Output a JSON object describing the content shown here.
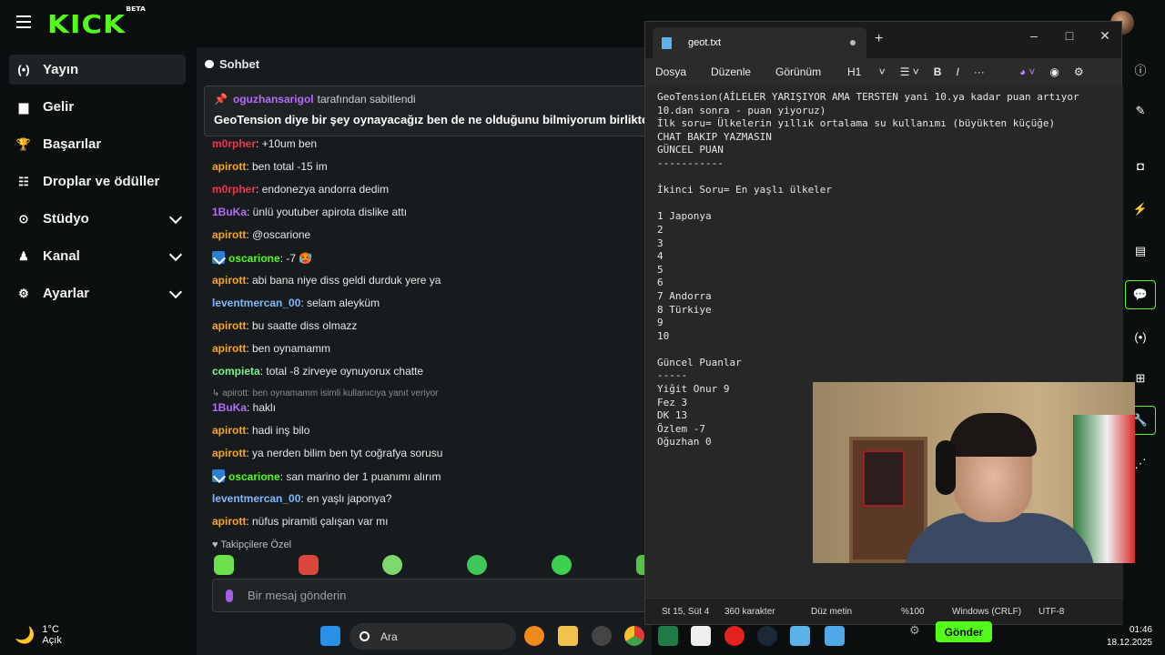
{
  "app": {
    "logo": "KICK",
    "logo_tag": "BETA"
  },
  "sidebar": {
    "items": [
      {
        "label": "Yayın",
        "icon": "broadcast-icon",
        "glyph": "(•)",
        "active": true,
        "expandable": false
      },
      {
        "label": "Gelir",
        "icon": "chart-icon",
        "glyph": "▆",
        "active": false,
        "expandable": false
      },
      {
        "label": "Başarılar",
        "icon": "trophy-icon",
        "glyph": "🏆",
        "active": false,
        "expandable": false
      },
      {
        "label": "Droplar ve ödüller",
        "icon": "drops-icon",
        "glyph": "☷",
        "active": false,
        "expandable": false
      },
      {
        "label": "Stüdyo",
        "icon": "studio-icon",
        "glyph": "⊙",
        "active": false,
        "expandable": true
      },
      {
        "label": "Kanal",
        "icon": "channel-icon",
        "glyph": "♟",
        "active": false,
        "expandable": true
      },
      {
        "label": "Ayarlar",
        "icon": "gear-icon",
        "glyph": "⚙",
        "active": false,
        "expandable": true
      }
    ]
  },
  "weather": {
    "temp": "1°C",
    "condition": "Açık"
  },
  "chat": {
    "title": "Sohbet",
    "pinned": {
      "user": "oguzhansarigol",
      "suffix": "tarafından sabitlendi",
      "message": "GeoTension diye bir şey oynayacağız ben de ne olduğunu bilmiyorum birlikte öğrenicez"
    },
    "messages": [
      {
        "user": "m0rpher",
        "color": "#e8384f",
        "text": ": +10um ben",
        "badge": false
      },
      {
        "user": "apirott",
        "color": "#f5a623",
        "text": ": ben total -15 im",
        "badge": false
      },
      {
        "user": "m0rpher",
        "color": "#e8384f",
        "text": ": endonezya andorra dedim",
        "badge": false
      },
      {
        "user": "1BuKa",
        "color": "#b46cf7",
        "text": ": ünlü youtuber apirota dislike attı",
        "badge": false
      },
      {
        "user": "apirott",
        "color": "#f5a623",
        "text": ": @oscarione",
        "badge": false
      },
      {
        "user": "oscarione",
        "color": "#53fc18",
        "text": ": -7 🥵",
        "badge": true
      },
      {
        "user": "apirott",
        "color": "#f5a623",
        "text": ": abi bana niye diss geldi durduk yere ya",
        "badge": false
      },
      {
        "user": "leventmercan_00",
        "color": "#7fb8ff",
        "text": ": selam aleyküm",
        "badge": false
      },
      {
        "user": "apirott",
        "color": "#f5a623",
        "text": ": bu saatte diss olmazz",
        "badge": false
      },
      {
        "user": "apirott",
        "color": "#f5a623",
        "text": ": ben oynamamm",
        "badge": false
      },
      {
        "user": "compieta",
        "color": "#7ef28c",
        "text": ": total -8 zirveye oynuyorux chatte",
        "badge": false
      },
      {
        "reply": "↳ apirott: ben oynamamm isimli kullanıcıya yanıt veriyor"
      },
      {
        "user": "1BuKa",
        "color": "#b46cf7",
        "text": ": haklı",
        "badge": false
      },
      {
        "user": "apirott",
        "color": "#f5a623",
        "text": ": hadi inş bilo",
        "badge": false
      },
      {
        "user": "apirott",
        "color": "#f5a623",
        "text": ": ya nerden bilim ben tyt coğrafya sorusu",
        "badge": false
      },
      {
        "user": "oscarione",
        "color": "#53fc18",
        "text": ": san marino der 1 puanımı alırım",
        "badge": true
      },
      {
        "user": "leventmercan_00",
        "color": "#7fb8ff",
        "text": ": en yaşlı japonya?",
        "badge": false
      },
      {
        "user": "apirott",
        "color": "#f5a623",
        "text": ": nüfus piramiti çalışan var mı",
        "badge": false
      }
    ],
    "follower_label": "♥ Takipçilere Özel",
    "input_placeholder": "Bir mesaj gönderin",
    "send_label": "Gönder"
  },
  "notepad": {
    "tab_title": "geot.txt",
    "menu": [
      "Dosya",
      "Düzenle",
      "Görünüm"
    ],
    "heading_selector": "H1",
    "text": "GeoTension(AİLELER YARIŞIYOR AMA TERSTEN yani 10.ya kadar puan artıyor\n10.dan sonra - puan yiyoruz)\nİlk soru= Ülkelerin yıllık ortalama su kullanımı (büyükten küçüğe)\nCHAT BAKIP YAZMASIN\nGÜNCEL PUAN\n-----------\n\nİkinci Soru= En yaşlı ülkeler\n\n1 Japonya\n2\n3\n4\n5\n6\n7 Andorra\n8 Türkiye\n9\n10\n\nGüncel Puanlar\n-----\nYiğit Onur 9\nFez 3\nDK 13\nÖzlem -7\nOğuzhan 0",
    "status": {
      "position": "St 15, Süt 4",
      "chars": "360 karakter",
      "format": "Düz metin",
      "zoom": "%100",
      "line_ending": "Windows (CRLF)",
      "encoding": "UTF-8"
    }
  },
  "taskbar": {
    "search_label": "Ara",
    "time": "01:46",
    "date": "18.12.2025"
  }
}
